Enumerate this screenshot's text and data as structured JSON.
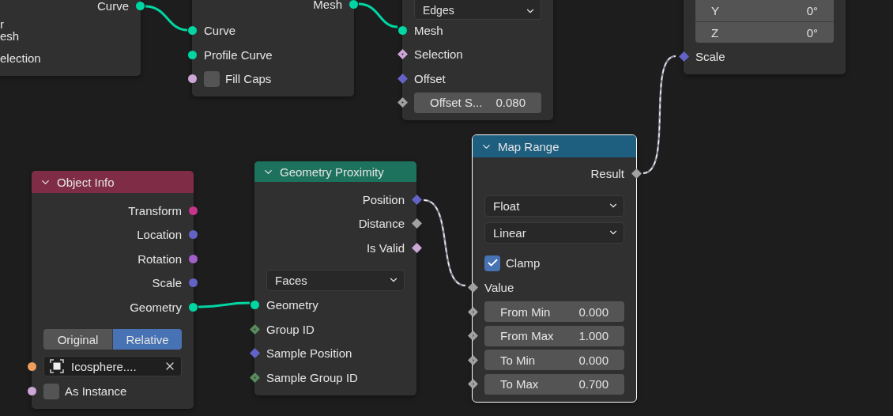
{
  "nodes": [
    {
      "selected": false,
      "rows": [
        {
          "kind": "output",
          "label": "Curve",
          "socket": {
            "kind": "circle",
            "color": "#00d6a3"
          }
        },
        {
          "kind": "multiline",
          "lines": [
            "r",
            "esh"
          ]
        },
        {
          "kind": "input",
          "label": "election"
        }
      ]
    },
    {
      "selected": false,
      "rows": [
        {
          "kind": "output",
          "label": "Mesh",
          "socket": {
            "kind": "circle",
            "color": "#00d6a3"
          }
        },
        {
          "kind": "input",
          "label": "Curve",
          "socket": {
            "kind": "circle",
            "color": "#00d6a3"
          }
        },
        {
          "kind": "input",
          "label": "Profile Curve",
          "socket": {
            "kind": "circle",
            "color": "#00d6a3"
          }
        },
        {
          "kind": "input_checkbox",
          "label": "Fill Caps",
          "checked": false,
          "socket": {
            "kind": "circle",
            "color": "#cca6d6"
          }
        }
      ]
    },
    {
      "selected": false,
      "rows": [
        {
          "kind": "dropdown",
          "value": "Edges"
        },
        {
          "kind": "input",
          "label": "Mesh",
          "socket": {
            "kind": "circle",
            "color": "#00d6a3"
          }
        },
        {
          "kind": "input",
          "label": "Selection",
          "socket": {
            "kind": "diamond_dot",
            "color": "#cca6d6"
          }
        },
        {
          "kind": "input",
          "label": "Offset",
          "socket": {
            "kind": "diamond",
            "color": "#6363c7"
          }
        },
        {
          "kind": "field",
          "label": "Offset S...",
          "value": "0.080",
          "socket": {
            "kind": "diamond_dot",
            "color": "#a1a1a1"
          }
        }
      ]
    },
    {
      "selected": false,
      "rows": [
        {
          "kind": "vector",
          "components": [
            {
              "axis": "Y",
              "value": "0°"
            },
            {
              "axis": "Z",
              "value": "0°"
            }
          ]
        },
        {
          "kind": "input",
          "label": "Scale",
          "socket": {
            "kind": "diamond",
            "color": "#6363c7"
          }
        }
      ]
    },
    {
      "title": "Object Info",
      "color": "#7f2d47",
      "selected": false,
      "rows": [
        {
          "kind": "output",
          "label": "Transform",
          "socket": {
            "kind": "circle",
            "color": "#c7358a"
          }
        },
        {
          "kind": "output",
          "label": "Location",
          "socket": {
            "kind": "circle",
            "color": "#6363c7"
          }
        },
        {
          "kind": "output",
          "label": "Rotation",
          "socket": {
            "kind": "circle",
            "color": "#a35fc9"
          }
        },
        {
          "kind": "output",
          "label": "Scale",
          "socket": {
            "kind": "circle",
            "color": "#6363c7"
          }
        },
        {
          "kind": "output",
          "label": "Geometry",
          "socket": {
            "kind": "circle",
            "color": "#00d6a3"
          }
        },
        {
          "kind": "toggle",
          "options": [
            {
              "label": "Original",
              "selected": false
            },
            {
              "label": "Relative",
              "selected": true
            }
          ]
        },
        {
          "kind": "object",
          "value": "Icosphere....",
          "socket": {
            "kind": "circle",
            "color": "#ed9e5c"
          }
        },
        {
          "kind": "input_checkbox",
          "label": "As Instance",
          "checked": false,
          "socket": {
            "kind": "circle",
            "color": "#cca6d6"
          }
        }
      ]
    },
    {
      "title": "Geometry Proximity",
      "color": "#1d725e",
      "selected": false,
      "rows": [
        {
          "kind": "output",
          "label": "Position",
          "socket": {
            "kind": "diamond",
            "color": "#6363c7"
          }
        },
        {
          "kind": "output",
          "label": "Distance",
          "socket": {
            "kind": "diamond",
            "color": "#a1a1a1"
          }
        },
        {
          "kind": "output",
          "label": "Is Valid",
          "socket": {
            "kind": "diamond",
            "color": "#cca6d6"
          }
        },
        {
          "kind": "dropdown",
          "value": "Faces"
        },
        {
          "kind": "input",
          "label": "Geometry",
          "socket": {
            "kind": "circle",
            "color": "#00d6a3"
          }
        },
        {
          "kind": "input",
          "label": "Group ID",
          "socket": {
            "kind": "diamond_dot",
            "color": "#598c5c"
          }
        },
        {
          "kind": "input",
          "label": "Sample Position",
          "socket": {
            "kind": "diamond",
            "color": "#6363c7"
          }
        },
        {
          "kind": "input",
          "label": "Sample Group ID",
          "socket": {
            "kind": "diamond_dot",
            "color": "#598c5c"
          }
        }
      ]
    },
    {
      "title": "Map Range",
      "color": "#1e5f80",
      "selected": true,
      "rows": [
        {
          "kind": "output",
          "label": "Result",
          "socket": {
            "kind": "diamond",
            "color": "#a1a1a1"
          }
        },
        {
          "kind": "dropdown",
          "value": "Float"
        },
        {
          "kind": "dropdown",
          "value": "Linear"
        },
        {
          "kind": "checkbox",
          "label": "Clamp",
          "checked": true
        },
        {
          "kind": "input",
          "label": "Value",
          "socket": {
            "kind": "diamond",
            "color": "#a1a1a1"
          }
        },
        {
          "kind": "field",
          "label": "From Min",
          "value": "0.000",
          "socket": {
            "kind": "diamond_dot",
            "color": "#a1a1a1"
          }
        },
        {
          "kind": "field",
          "label": "From Max",
          "value": "1.000",
          "socket": {
            "kind": "diamond_dot",
            "color": "#a1a1a1"
          }
        },
        {
          "kind": "field",
          "label": "To Min",
          "value": "0.000",
          "socket": {
            "kind": "diamond_dot",
            "color": "#a1a1a1"
          }
        },
        {
          "kind": "field",
          "label": "To Max",
          "value": "0.700",
          "socket": {
            "kind": "diamond_dot",
            "color": "#a1a1a1"
          }
        }
      ]
    }
  ],
  "links": [
    {
      "kind": "geometry"
    },
    {
      "kind": "geometry"
    },
    {
      "kind": "geometry"
    },
    {
      "kind": "field"
    },
    {
      "kind": "field"
    }
  ]
}
